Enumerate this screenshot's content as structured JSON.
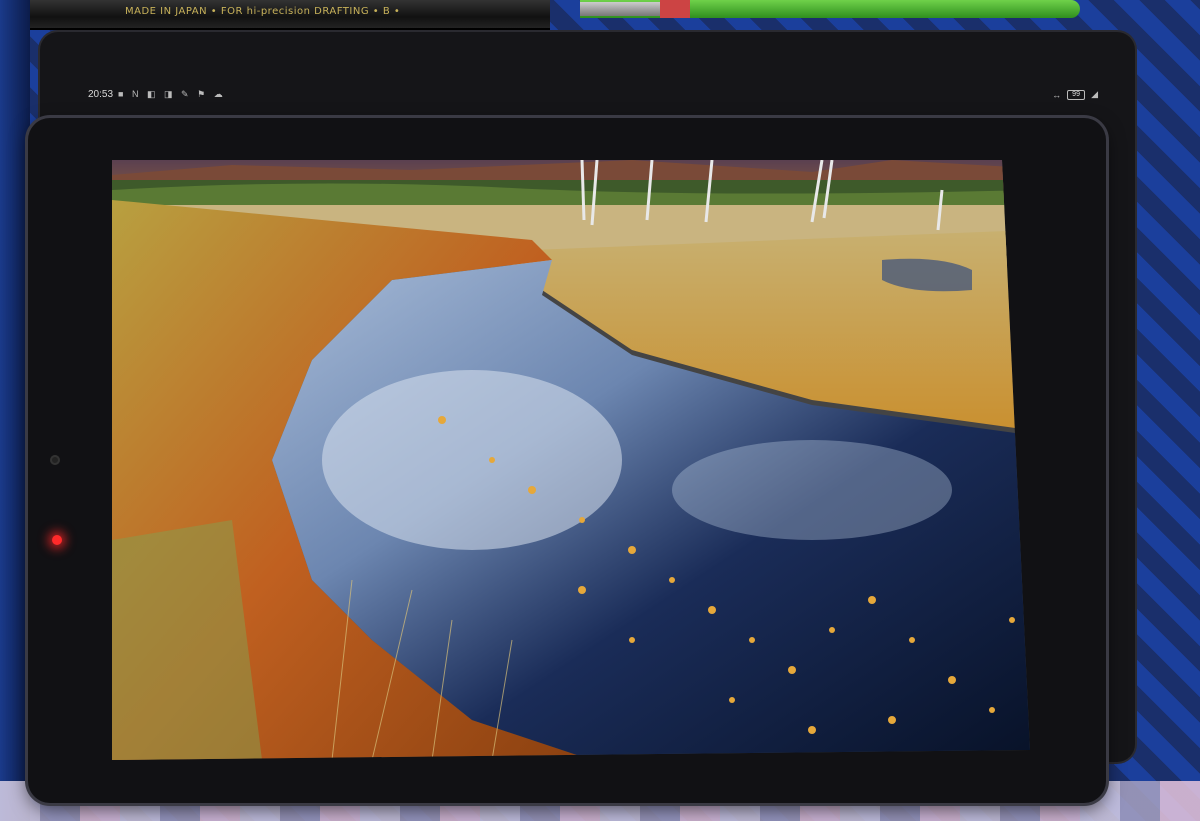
{
  "pencil": {
    "imprint": "MADE IN JAPAN • FOR hi-precision DRAFTING  • B •"
  },
  "status_bar": {
    "time": "20:53",
    "icons": [
      "notification-icon",
      "n-icon",
      "app-icon",
      "app-icon",
      "app-icon",
      "app-icon",
      "cloud-icon"
    ],
    "right_icons": [
      "link-icon",
      "battery-icon",
      "signal-icon"
    ],
    "battery_text": "99"
  },
  "scene": {
    "description_colors": {
      "sky_mountain": "#7a5a4a",
      "forest": "#3e5a2a",
      "grass_gold": "#c9a040",
      "grass_orange": "#b85a18",
      "water_dark": "#0c1830",
      "water_reflect": "#8aa4c8",
      "led": "#ff2a2a"
    }
  }
}
